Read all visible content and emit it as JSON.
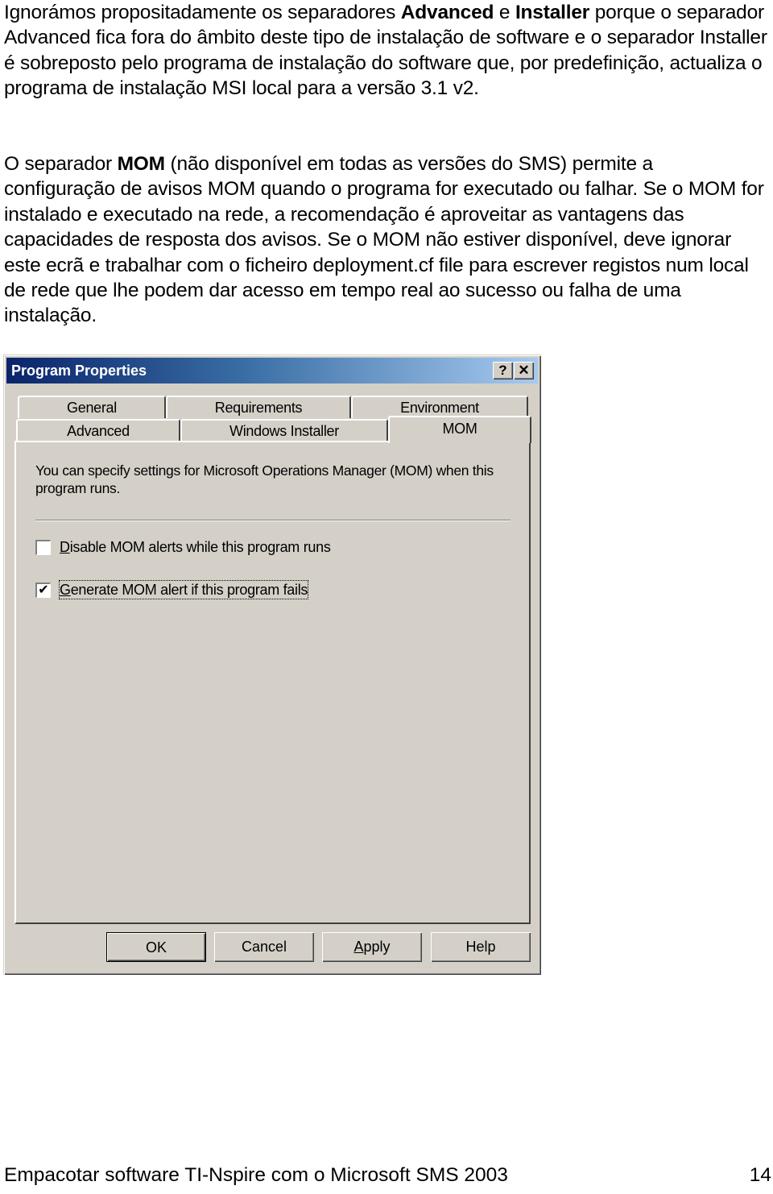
{
  "document": {
    "paragraph1": {
      "part1": "Ignorámos propositadamente os separadores ",
      "bold1": "Advanced",
      "part2": " e ",
      "bold2": "Installer",
      "part3": " porque o separador Advanced fica fora do âmbito deste tipo de instalação de software e o separador Installer é sobreposto pelo programa de instalação do software que, por predefinição, actualiza o programa de instalação MSI local para a versão 3.1 v2."
    },
    "paragraph2": {
      "part1": "O separador ",
      "bold1": "MOM",
      "part2": " (não disponível em todas as versões do SMS) permite a configuração de avisos MOM quando o programa for executado ou falhar. Se o MOM for instalado e executado na rede, a recomendação é aproveitar as vantagens das capacidades de resposta dos avisos. Se o MOM não estiver disponível, deve ignorar este ecrã e trabalhar com o ficheiro deployment.cf file para escrever registos num local de rede que lhe podem dar acesso em tempo real ao sucesso ou falha de uma instalação."
    },
    "footer": {
      "title": "Empacotar software TI-Nspire com o Microsoft SMS 2003",
      "page_number": "14"
    }
  },
  "dialog": {
    "title": "Program Properties",
    "titlebar_buttons": {
      "help": "?",
      "close": "✕"
    },
    "tabs_row1": [
      {
        "label": "General"
      },
      {
        "label": "Requirements"
      },
      {
        "label": "Environment"
      }
    ],
    "tabs_row2": [
      {
        "label": "Advanced"
      },
      {
        "label": "Windows Installer"
      },
      {
        "label": "MOM",
        "active": true
      }
    ],
    "description": "You can specify settings for Microsoft Operations Manager (MOM) when this program runs.",
    "checkboxes": [
      {
        "mnemonic": "D",
        "rest": "isable MOM alerts while this program runs",
        "checked": false,
        "mark": ""
      },
      {
        "mnemonic": "G",
        "rest": "enerate MOM alert if this program fails",
        "checked": true,
        "mark": "✔"
      }
    ],
    "buttons": {
      "ok": "OK",
      "cancel": "Cancel",
      "apply_mnemonic": "A",
      "apply_rest": "pply",
      "help": "Help"
    },
    "colors": {
      "face": "#d4d0c8",
      "title_start": "#0a246a",
      "title_end": "#a6caf0"
    }
  }
}
